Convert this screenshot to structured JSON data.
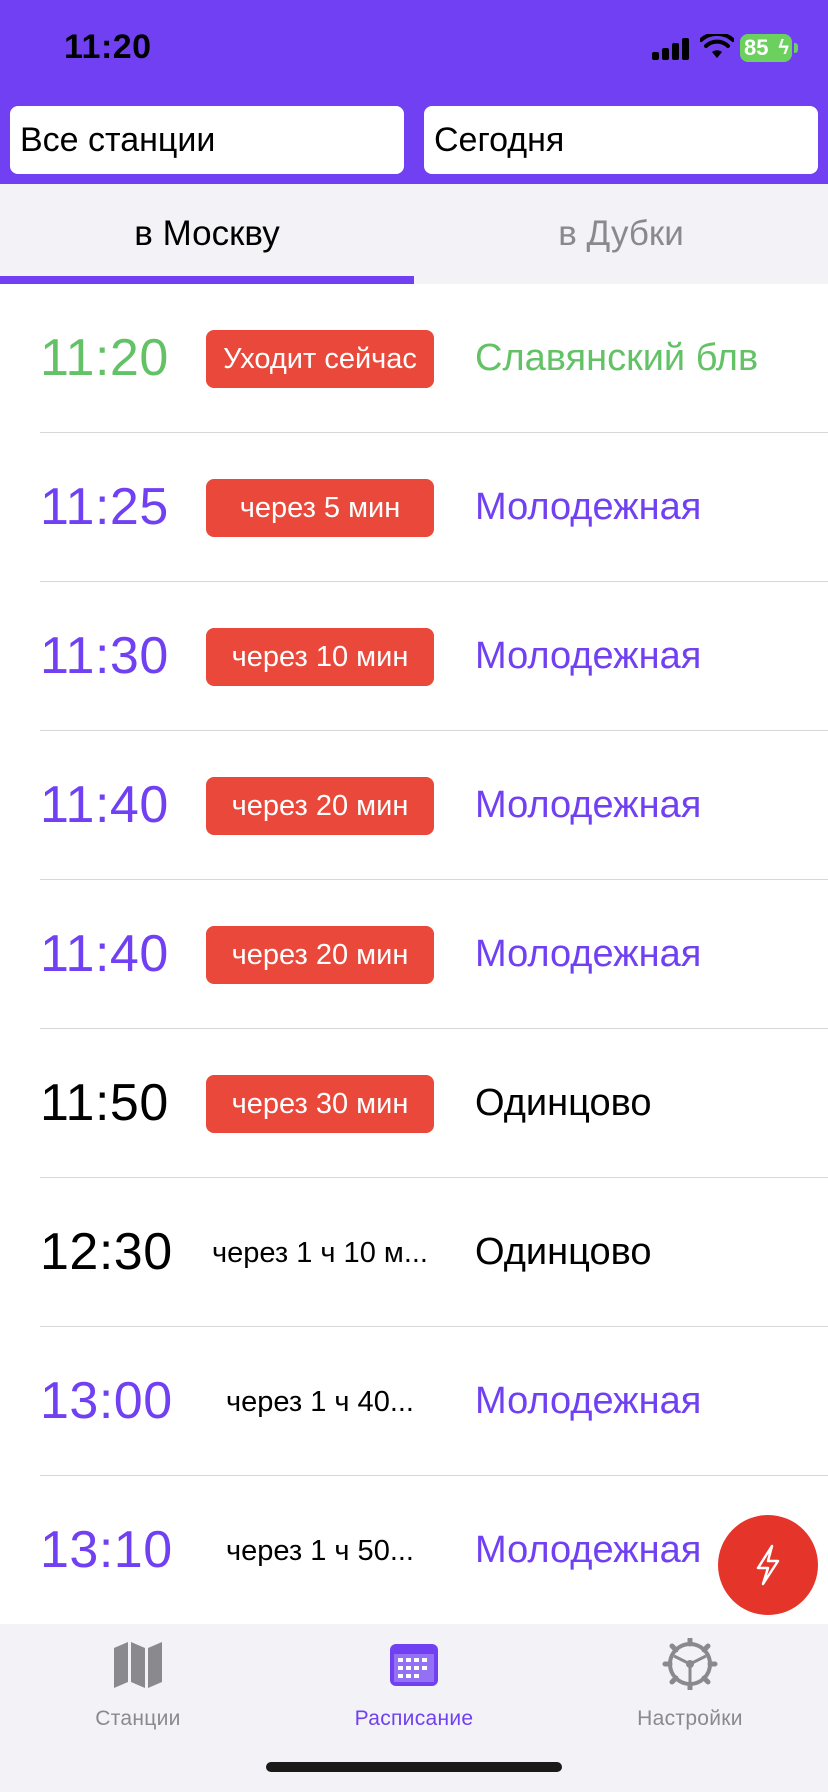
{
  "status_bar": {
    "time": "11:20",
    "battery": "85"
  },
  "filters": {
    "station": "Все станции",
    "date": "Сегодня"
  },
  "direction_tabs": {
    "to_moscow": "в Москву",
    "to_dubki": "в Дубки",
    "active": "to_moscow"
  },
  "colors": {
    "accent": "#7040F2",
    "departing_now": "#63C266",
    "badge_red": "#E9483A",
    "fab": "#E5352A"
  },
  "departures": [
    {
      "time": "11:20",
      "status": "Уходит сейчас",
      "destination": "Славянский блв",
      "color": "green",
      "badge": "red"
    },
    {
      "time": "11:25",
      "status": "через 5 мин",
      "destination": "Молодежная",
      "color": "purple",
      "badge": "red"
    },
    {
      "time": "11:30",
      "status": "через 10 мин",
      "destination": "Молодежная",
      "color": "purple",
      "badge": "red"
    },
    {
      "time": "11:40",
      "status": "через 20 мин",
      "destination": "Молодежная",
      "color": "purple",
      "badge": "red"
    },
    {
      "time": "11:40",
      "status": "через 20 мин",
      "destination": "Молодежная",
      "color": "purple",
      "badge": "red"
    },
    {
      "time": "11:50",
      "status": "через 30 мин",
      "destination": "Одинцово",
      "color": "black",
      "badge": "red"
    },
    {
      "time": "12:30",
      "status": "через 1 ч 10 м...",
      "destination": "Одинцово",
      "color": "black",
      "badge": "plain"
    },
    {
      "time": "13:00",
      "status": "через 1 ч 40...",
      "destination": "Молодежная",
      "color": "purple",
      "badge": "plain"
    },
    {
      "time": "13:10",
      "status": "через 1 ч 50...",
      "destination": "Молодежная",
      "color": "purple",
      "badge": "plain"
    }
  ],
  "fab": {
    "icon": "bolt-icon"
  },
  "tab_bar": {
    "stations": {
      "label": "Станции",
      "icon": "map-icon"
    },
    "schedule": {
      "label": "Расписание",
      "icon": "calendar-icon"
    },
    "settings": {
      "label": "Настройки",
      "icon": "gear-icon"
    },
    "active": "schedule"
  }
}
